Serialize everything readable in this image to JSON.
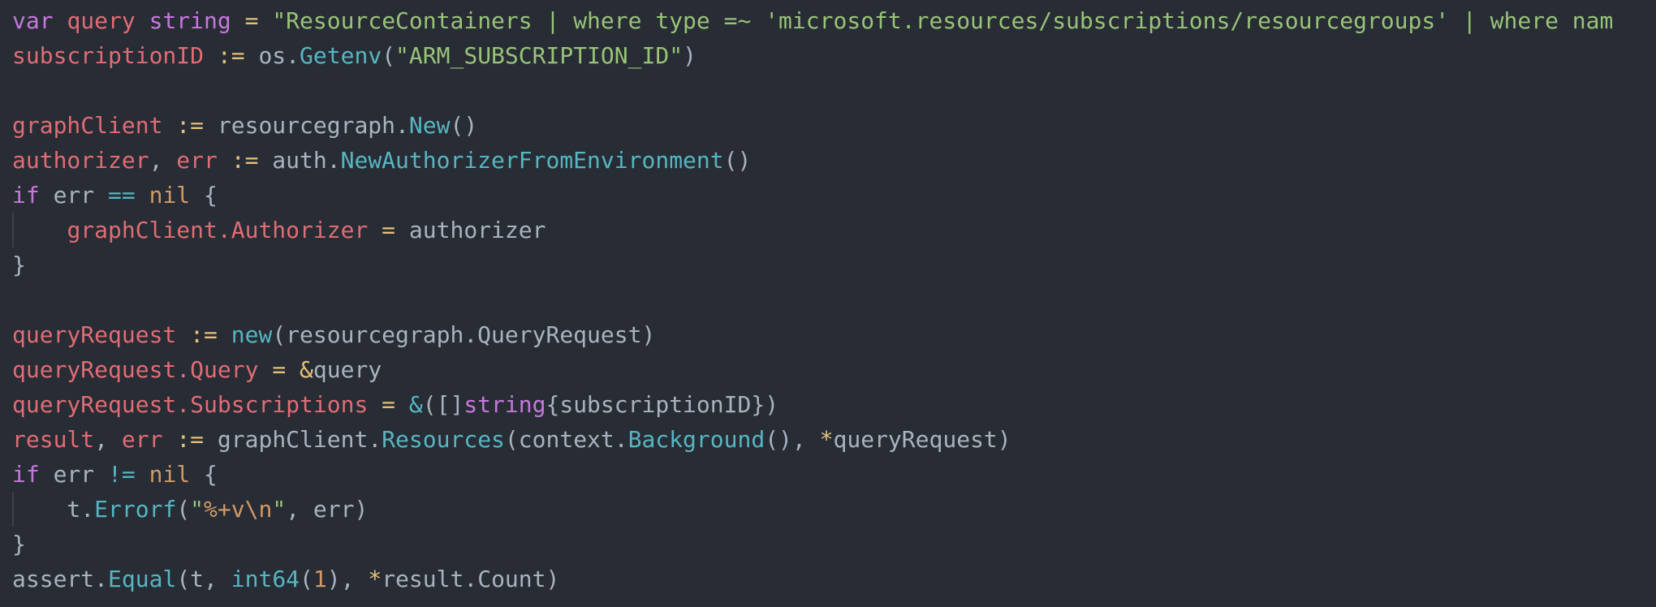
{
  "colors": {
    "background": "#282c34",
    "plain": "#abb2bf",
    "keyword": "#c678dd",
    "variable": "#e06c75",
    "string": "#98c379",
    "function": "#56b6c2",
    "operator": "#e5c07b",
    "number": "#d19a66"
  },
  "lines": [
    {
      "tokens": [
        {
          "t": "var",
          "c": "k"
        },
        {
          "t": " ",
          "c": "p"
        },
        {
          "t": "query",
          "c": "v"
        },
        {
          "t": " ",
          "c": "p"
        },
        {
          "t": "string",
          "c": "k"
        },
        {
          "t": " ",
          "c": "p"
        },
        {
          "t": "=",
          "c": "o"
        },
        {
          "t": " ",
          "c": "p"
        },
        {
          "t": "\"ResourceContainers | where type =~ 'microsoft.resources/subscriptions/resourcegroups' | where nam",
          "c": "s"
        }
      ]
    },
    {
      "tokens": [
        {
          "t": "subscriptionID",
          "c": "v"
        },
        {
          "t": " ",
          "c": "p"
        },
        {
          "t": ":=",
          "c": "o"
        },
        {
          "t": " os.",
          "c": "p"
        },
        {
          "t": "Getenv",
          "c": "f"
        },
        {
          "t": "(",
          "c": "p"
        },
        {
          "t": "\"ARM_SUBSCRIPTION_ID\"",
          "c": "s"
        },
        {
          "t": ")",
          "c": "p"
        }
      ]
    },
    {
      "tokens": []
    },
    {
      "tokens": [
        {
          "t": "graphClient",
          "c": "v"
        },
        {
          "t": " ",
          "c": "p"
        },
        {
          "t": ":=",
          "c": "o"
        },
        {
          "t": " resourcegraph.",
          "c": "p"
        },
        {
          "t": "New",
          "c": "f"
        },
        {
          "t": "()",
          "c": "p"
        }
      ]
    },
    {
      "tokens": [
        {
          "t": "authorizer",
          "c": "v"
        },
        {
          "t": ", ",
          "c": "p"
        },
        {
          "t": "err",
          "c": "v"
        },
        {
          "t": " ",
          "c": "p"
        },
        {
          "t": ":=",
          "c": "o"
        },
        {
          "t": " auth.",
          "c": "p"
        },
        {
          "t": "NewAuthorizerFromEnvironment",
          "c": "f"
        },
        {
          "t": "()",
          "c": "p"
        }
      ]
    },
    {
      "tokens": [
        {
          "t": "if",
          "c": "k"
        },
        {
          "t": " err ",
          "c": "p"
        },
        {
          "t": "==",
          "c": "f"
        },
        {
          "t": " ",
          "c": "p"
        },
        {
          "t": "nil",
          "c": "n"
        },
        {
          "t": " {",
          "c": "p"
        }
      ]
    },
    {
      "indent": true,
      "tokens": [
        {
          "t": "    ",
          "c": "p"
        },
        {
          "t": "graphClient.",
          "c": "v"
        },
        {
          "t": "Authorizer",
          "c": "v"
        },
        {
          "t": " ",
          "c": "p"
        },
        {
          "t": "=",
          "c": "o"
        },
        {
          "t": " authorizer",
          "c": "p"
        }
      ]
    },
    {
      "tokens": [
        {
          "t": "}",
          "c": "p"
        }
      ]
    },
    {
      "tokens": []
    },
    {
      "tokens": [
        {
          "t": "queryRequest",
          "c": "v"
        },
        {
          "t": " ",
          "c": "p"
        },
        {
          "t": ":=",
          "c": "o"
        },
        {
          "t": " ",
          "c": "p"
        },
        {
          "t": "new",
          "c": "f"
        },
        {
          "t": "(resourcegraph.QueryRequest)",
          "c": "p"
        }
      ]
    },
    {
      "tokens": [
        {
          "t": "queryRequest.",
          "c": "v"
        },
        {
          "t": "Query",
          "c": "v"
        },
        {
          "t": " ",
          "c": "p"
        },
        {
          "t": "=",
          "c": "o"
        },
        {
          "t": " ",
          "c": "p"
        },
        {
          "t": "&",
          "c": "o"
        },
        {
          "t": "query",
          "c": "p"
        }
      ]
    },
    {
      "tokens": [
        {
          "t": "queryRequest.",
          "c": "v"
        },
        {
          "t": "Subscriptions",
          "c": "v"
        },
        {
          "t": " ",
          "c": "p"
        },
        {
          "t": "=",
          "c": "o"
        },
        {
          "t": " ",
          "c": "p"
        },
        {
          "t": "&",
          "c": "f"
        },
        {
          "t": "([]",
          "c": "p"
        },
        {
          "t": "string",
          "c": "k"
        },
        {
          "t": "{subscriptionID})",
          "c": "p"
        }
      ]
    },
    {
      "tokens": [
        {
          "t": "result",
          "c": "v"
        },
        {
          "t": ", ",
          "c": "p"
        },
        {
          "t": "err",
          "c": "v"
        },
        {
          "t": " ",
          "c": "p"
        },
        {
          "t": ":=",
          "c": "o"
        },
        {
          "t": " graphClient.",
          "c": "p"
        },
        {
          "t": "Resources",
          "c": "f"
        },
        {
          "t": "(context.",
          "c": "p"
        },
        {
          "t": "Background",
          "c": "f"
        },
        {
          "t": "(), ",
          "c": "p"
        },
        {
          "t": "*",
          "c": "o"
        },
        {
          "t": "queryRequest)",
          "c": "p"
        }
      ]
    },
    {
      "tokens": [
        {
          "t": "if",
          "c": "k"
        },
        {
          "t": " err ",
          "c": "p"
        },
        {
          "t": "!=",
          "c": "f"
        },
        {
          "t": " ",
          "c": "p"
        },
        {
          "t": "nil",
          "c": "n"
        },
        {
          "t": " {",
          "c": "p"
        }
      ]
    },
    {
      "indent": true,
      "tokens": [
        {
          "t": "    t.",
          "c": "p"
        },
        {
          "t": "Errorf",
          "c": "f"
        },
        {
          "t": "(",
          "c": "p"
        },
        {
          "t": "\"",
          "c": "s"
        },
        {
          "t": "%+v\\n",
          "c": "n"
        },
        {
          "t": "\"",
          "c": "s"
        },
        {
          "t": ", err)",
          "c": "p"
        }
      ]
    },
    {
      "tokens": [
        {
          "t": "}",
          "c": "p"
        }
      ]
    },
    {
      "tokens": [
        {
          "t": "assert.",
          "c": "p"
        },
        {
          "t": "Equal",
          "c": "f"
        },
        {
          "t": "(t, ",
          "c": "p"
        },
        {
          "t": "int64",
          "c": "f"
        },
        {
          "t": "(",
          "c": "p"
        },
        {
          "t": "1",
          "c": "n"
        },
        {
          "t": "), ",
          "c": "p"
        },
        {
          "t": "*",
          "c": "o"
        },
        {
          "t": "result.Count)",
          "c": "p"
        }
      ]
    }
  ]
}
